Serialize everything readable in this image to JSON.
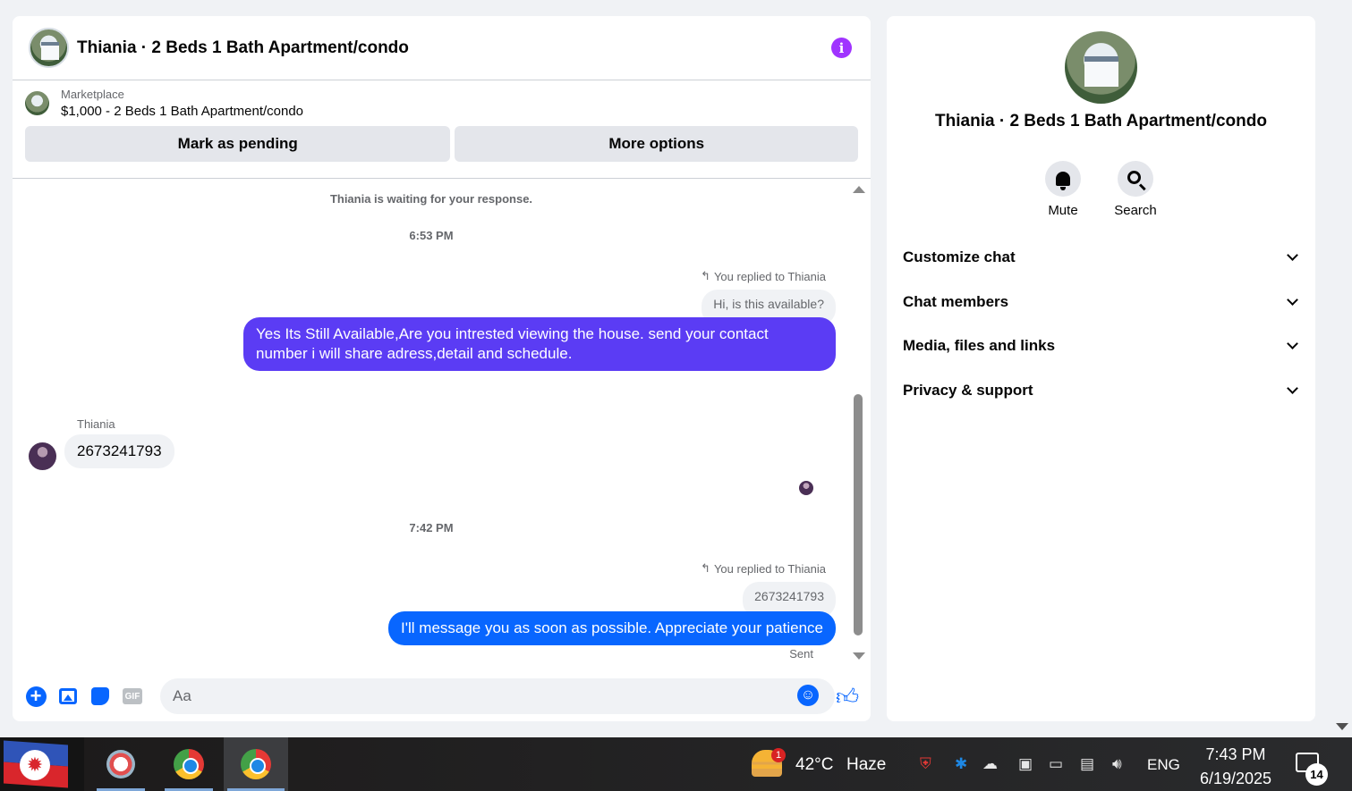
{
  "chat": {
    "title": "Thiania · 2 Beds 1 Bath Apartment/condo",
    "info_icon": "info-icon",
    "listing": {
      "category": "Marketplace",
      "price_title": "$1,000 - 2 Beds 1 Bath Apartment/condo",
      "mark_pending": "Mark as pending",
      "more_options": "More options"
    },
    "messages": {
      "waiting": "Thiania is waiting for your response.",
      "time1": "6:53 PM",
      "replied1": "You replied to Thiania",
      "quoted1": "Hi, is this available?",
      "out1": "Yes Its Still Available,Are you intrested viewing the house. send your contact number i will share adress,detail and schedule.",
      "sender": "Thiania",
      "in1": "2673241793",
      "time2": "7:42 PM",
      "replied2": "You replied to Thiania",
      "quoted2": "2673241793",
      "out2": "I'll message you as soon as possible. Appreciate your patience",
      "status": "Sent"
    },
    "composer": {
      "placeholder": "Aa",
      "gif_label": "GIF"
    }
  },
  "info": {
    "title": "Thiania · 2 Beds 1 Bath Apartment/condo",
    "mute": "Mute",
    "search": "Search",
    "sections": [
      "Customize chat",
      "Chat members",
      "Media, files and links",
      "Privacy & support"
    ]
  },
  "taskbar": {
    "weather_badge": "1",
    "temperature": "42°C",
    "condition": "Haze",
    "language": "ENG",
    "time": "7:43 PM",
    "date": "6/19/2025",
    "notifications": "14"
  },
  "colors": {
    "purple_bubble": "#5b3cf4",
    "blue_bubble": "#0866ff",
    "info_accent": "#a033ff"
  }
}
